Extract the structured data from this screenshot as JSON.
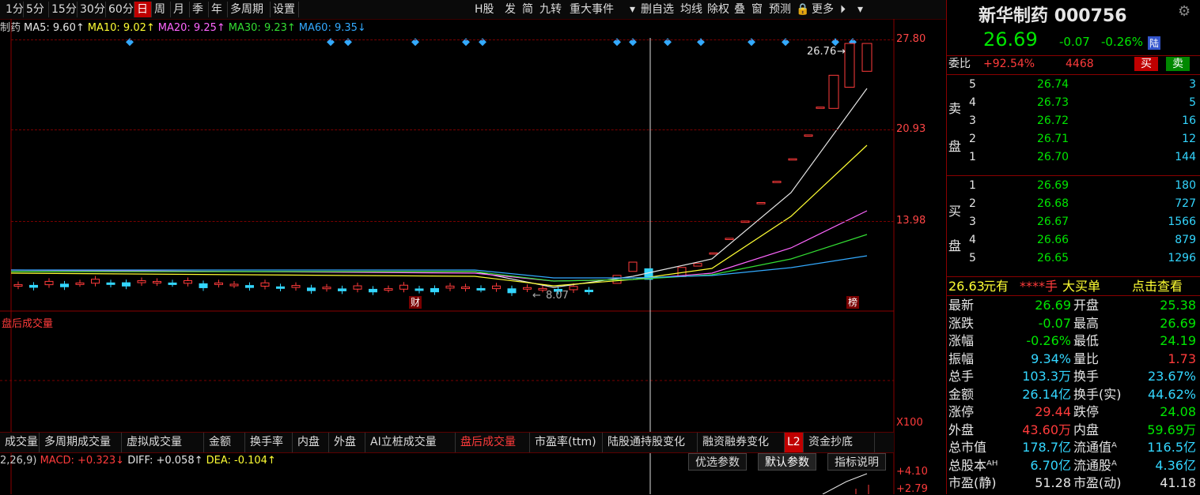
{
  "toolbar": {
    "periods": [
      "1分",
      "5分",
      "15分",
      "30分",
      "60分",
      "日",
      "周",
      "月",
      "季",
      "年",
      "多周期",
      "设置"
    ],
    "active_period": "日",
    "right_items": [
      "H股",
      "发",
      "简",
      "九转",
      "重大事件",
      "▾",
      "删自选",
      "均线",
      "除权",
      "叠",
      "窗",
      "预测",
      "🔒",
      "更多",
      "⏵",
      "▾"
    ]
  },
  "ma_line": {
    "prefix": "制药",
    "items": [
      {
        "label": "MA5: 9.60↑",
        "color": "#e6e6e6"
      },
      {
        "label": "MA10: 9.02↑",
        "color": "#ffff33"
      },
      {
        "label": "MA20: 9.25↑",
        "color": "#ff66ff"
      },
      {
        "label": "MA30: 9.23↑",
        "color": "#33dd33"
      },
      {
        "label": "MA60: 9.35↓",
        "color": "#33aaff"
      }
    ]
  },
  "price_axis": [
    "27.80",
    "20.93",
    "13.98"
  ],
  "chart_data": {
    "type": "candlestick",
    "y_axis_labels": [
      "27.80",
      "20.93",
      "13.98"
    ],
    "annotations": [
      "26.76",
      "8.07",
      "财",
      "榜"
    ],
    "last_close": 26.69,
    "high": 26.76,
    "low": 8.07
  },
  "chart_labels": {
    "high": "26.76",
    "low": "8.07",
    "fin": "财",
    "bang": "榜"
  },
  "volume_panel": {
    "title": "盘后成交量",
    "scale": "X100"
  },
  "tabs": [
    "成交量",
    "多周期成交量",
    "虚拟成交量",
    "金额",
    "换手率",
    "内盘",
    "外盘",
    "AI立桩成交量",
    "盘后成交量",
    "市盈率(ttm)",
    "陆股通持股变化",
    "融资融券变化",
    "L2",
    "资金抄底"
  ],
  "active_tab": "盘后成交量",
  "macd_line": {
    "prefix": "2,26,9)",
    "macd": "MACD: +0.323↓",
    "diff": "DIFF: +0.058↑",
    "dea": "DEA: -0.104↑",
    "axis_top": "+4.10",
    "axis_bottom": "+2.79"
  },
  "param_buttons": [
    "优选参数",
    "默认参数",
    "指标说明"
  ],
  "stock": {
    "name": "新华制药",
    "code": "000756",
    "price": "26.69",
    "change": "-0.07",
    "pct": "-0.26%",
    "badge": "陆"
  },
  "weibi": {
    "label": "委比",
    "pct": "+92.54%",
    "diff": "4468",
    "buy": "买",
    "sell": "卖"
  },
  "sell_side": {
    "label_top": "卖",
    "label_bottom": "盘",
    "rows": [
      {
        "level": "5",
        "price": "26.74",
        "vol": "3"
      },
      {
        "level": "4",
        "price": "26.73",
        "vol": "5"
      },
      {
        "level": "3",
        "price": "26.72",
        "vol": "16"
      },
      {
        "level": "2",
        "price": "26.71",
        "vol": "12"
      },
      {
        "level": "1",
        "price": "26.70",
        "vol": "144"
      }
    ]
  },
  "buy_side": {
    "label_top": "买",
    "label_bottom": "盘",
    "rows": [
      {
        "level": "1",
        "price": "26.69",
        "vol": "180"
      },
      {
        "level": "2",
        "price": "26.68",
        "vol": "727"
      },
      {
        "level": "3",
        "price": "26.67",
        "vol": "1566"
      },
      {
        "level": "4",
        "price": "26.66",
        "vol": "879"
      },
      {
        "level": "5",
        "price": "26.65",
        "vol": "1296"
      }
    ]
  },
  "big_order": {
    "price": "26.63",
    "unit": "元有",
    "stars": "****手",
    "label": "大买单",
    "link": "点击查看"
  },
  "quote": [
    {
      "l": "最新",
      "v": "26.69",
      "vc": "#00e600",
      "l2": "开盘",
      "v2": "25.38",
      "vc2": "#00e600"
    },
    {
      "l": "涨跌",
      "v": "-0.07",
      "vc": "#00e600",
      "l2": "最高",
      "v2": "26.69",
      "vc2": "#00e600"
    },
    {
      "l": "涨幅",
      "v": "-0.26%",
      "vc": "#00e600",
      "l2": "最低",
      "v2": "24.19",
      "vc2": "#00e600"
    },
    {
      "l": "振幅",
      "v": "9.34%",
      "vc": "#33d6ff",
      "l2": "量比",
      "v2": "1.73",
      "vc2": "#ff3b3b"
    },
    {
      "l": "总手",
      "v": "103.3万",
      "vc": "#33d6ff",
      "l2": "换手",
      "v2": "23.67%",
      "vc2": "#33d6ff"
    },
    {
      "l": "金额",
      "v": "26.14亿",
      "vc": "#33d6ff",
      "l2": "换手(实)",
      "v2": "44.62%",
      "vc2": "#33d6ff"
    },
    {
      "l": "涨停",
      "v": "29.44",
      "vc": "#ff3b3b",
      "l2": "跌停",
      "v2": "24.08",
      "vc2": "#00e600"
    },
    {
      "l": "外盘",
      "v": "43.60万",
      "vc": "#ff3b3b",
      "l2": "内盘",
      "v2": "59.69万",
      "vc2": "#00e600"
    },
    {
      "l": "总市值",
      "v": "178.7亿",
      "vc": "#33d6ff",
      "l2": "流通值ᴬ",
      "v2": "116.5亿",
      "vc2": "#33d6ff"
    },
    {
      "l": "总股本ᴬᴴ",
      "v": "6.70亿",
      "vc": "#33d6ff",
      "l2": "流通股ᴬ",
      "v2": "4.36亿",
      "vc2": "#33d6ff"
    },
    {
      "l": "市盈(静)",
      "v": "51.28",
      "vc": "#e6e6e6",
      "l2": "市盈(动)",
      "v2": "41.18",
      "vc2": "#e6e6e6"
    }
  ],
  "colors": {
    "up": "#ff3b3b",
    "down": "#00e600",
    "grid": "#7a0000",
    "cyan": "#33d6ff"
  }
}
